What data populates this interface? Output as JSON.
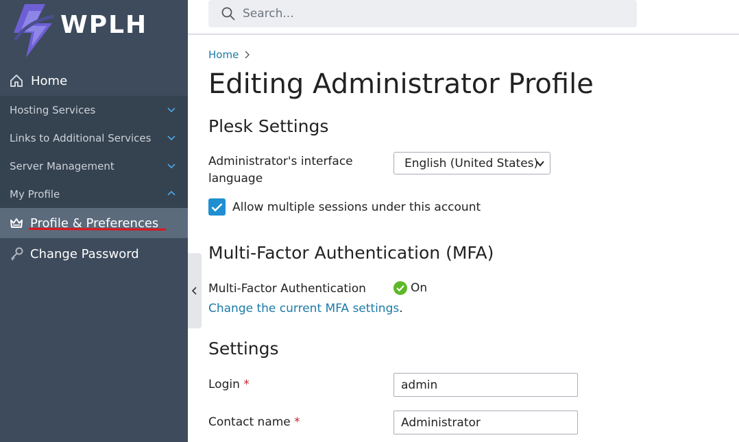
{
  "brand": {
    "name": "WPLH"
  },
  "sidebar": {
    "home_label": "Home",
    "sections": [
      {
        "label": "Hosting Services",
        "expanded": false
      },
      {
        "label": "Links to Additional Services",
        "expanded": false
      },
      {
        "label": "Server Management",
        "expanded": false
      },
      {
        "label": "My Profile",
        "expanded": true
      }
    ],
    "items": [
      {
        "label": "Profile & Preferences",
        "active": true,
        "icon": "crown-icon"
      },
      {
        "label": "Change Password",
        "active": false,
        "icon": "key-icon"
      }
    ]
  },
  "search": {
    "placeholder": "Search..."
  },
  "breadcrumb": {
    "home": "Home"
  },
  "page": {
    "title": "Editing Administrator Profile",
    "plesk_settings": {
      "heading": "Plesk Settings",
      "language_label_line1": "Administrator's interface",
      "language_label_line2": "language",
      "language_value": "English (United States)",
      "allow_sessions_label": "Allow multiple sessions under this account",
      "allow_sessions_checked": true
    },
    "mfa": {
      "heading": "Multi-Factor Authentication (MFA)",
      "label": "Multi-Factor Authentication",
      "status": "On",
      "link_text": "Change the current MFA settings",
      "link_suffix": "."
    },
    "settings": {
      "heading": "Settings",
      "login_label": "Login",
      "login_value": "admin",
      "contact_label": "Contact name",
      "contact_value": "Administrator",
      "required_marker": "*"
    }
  },
  "colors": {
    "sidebar_bg": "#3d4b5c",
    "sidebar_section_bg": "#35424f",
    "active_item_bg": "#5c6b7c",
    "link": "#1b7aa8",
    "checkbox": "#1f8fd1",
    "status_ok": "#5cb827",
    "annotation_underline": "#e0141b"
  }
}
